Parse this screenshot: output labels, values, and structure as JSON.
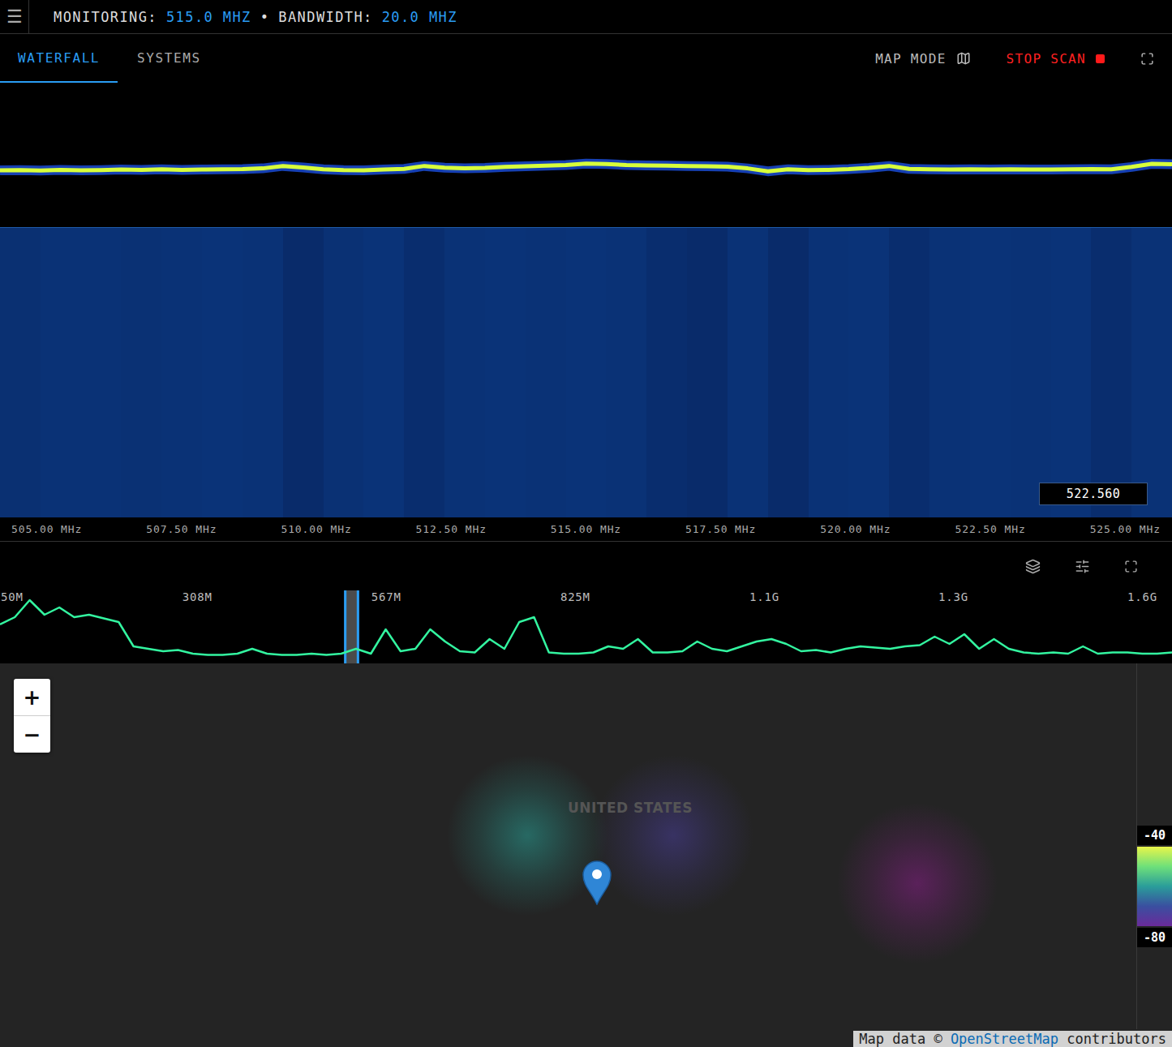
{
  "header": {
    "menu_icon": "☰",
    "separator": "•",
    "items": [
      {
        "label": "MONITORING:",
        "value": "515.0 MHZ"
      },
      {
        "label": "BANDWIDTH:",
        "value": "20.0 MHZ"
      }
    ]
  },
  "tabs": [
    {
      "label": "WATERFALL",
      "selected": true
    },
    {
      "label": "SYSTEMS",
      "selected": false
    }
  ],
  "actions": {
    "map_mode": "MAP MODE",
    "stop_scan": "STOP SCAN"
  },
  "spectrum": {
    "values": [
      -76.4,
      -76.3,
      -76.5,
      -76.2,
      -76.4,
      -76.3,
      -76.1,
      -76.2,
      -76.0,
      -76.2,
      -76.1,
      -76.0,
      -75.9,
      -75.6,
      -74.6,
      -75.2,
      -76.0,
      -76.3,
      -76.4,
      -76.1,
      -75.8,
      -74.6,
      -75.3,
      -75.6,
      -75.4,
      -75.0,
      -74.7,
      -74.5,
      -74.2,
      -73.6,
      -73.8,
      -74.2,
      -74.4,
      -74.5,
      -74.6,
      -74.7,
      -74.9,
      -75.6,
      -76.8,
      -76.0,
      -76.3,
      -76.2,
      -75.9,
      -75.4,
      -74.6,
      -75.8,
      -76.0,
      -76.1,
      -76.0,
      -76.1,
      -76.0,
      -76.1,
      -76.1,
      -76.0,
      -75.9,
      -76.0,
      -75.0,
      -73.7,
      -73.9
    ]
  },
  "waterfall": {
    "columns": [
      0.55,
      0.6,
      0.6,
      0.58,
      0.6,
      0.62,
      0.6,
      0.45,
      0.58,
      0.62,
      0.5,
      0.6,
      0.62,
      0.6,
      0.62,
      0.6,
      0.5,
      0.45,
      0.6,
      0.45,
      0.6,
      0.62,
      0.5,
      0.6,
      0.62,
      0.6,
      0.62,
      0.5,
      0.6
    ],
    "cursor": "522.560",
    "ticks": [
      "505.00 MHz",
      "507.50 MHz",
      "510.00 MHz",
      "512.50 MHz",
      "515.00 MHz",
      "517.50 MHz",
      "520.00 MHz",
      "522.50 MHz",
      "525.00 MHz"
    ]
  },
  "overview": {
    "ticks": [
      "50M",
      "308M",
      "567M",
      "825M",
      "1.1G",
      "1.3G",
      "1.6G"
    ],
    "values": [
      -68,
      -62,
      -48,
      -60,
      -54,
      -62,
      -60,
      -63,
      -66,
      -86,
      -88,
      -90,
      -89,
      -92,
      -93,
      -93,
      -92,
      -88,
      -92,
      -93,
      -93,
      -92,
      -93,
      -92,
      -88,
      -92,
      -72,
      -90,
      -88,
      -72,
      -82,
      -90,
      -91,
      -80,
      -88,
      -66,
      -62,
      -91,
      -92,
      -92,
      -91,
      -86,
      -88,
      -80,
      -91,
      -91,
      -90,
      -82,
      -88,
      -90,
      -86,
      -82,
      -80,
      -84,
      -90,
      -89,
      -91,
      -88,
      -86,
      -87,
      -88,
      -86,
      -85,
      -78,
      -84,
      -76,
      -88,
      -80,
      -88,
      -91,
      -92,
      -91,
      -92,
      -86,
      -92,
      -91,
      -91,
      -92,
      -92,
      -91
    ]
  },
  "map": {
    "label": "UNITED STATES",
    "zoom": [
      "+",
      "−"
    ],
    "pin": {
      "lat": 34.4,
      "lon": -103.2
    },
    "hotspots": [
      {
        "lat": 39.3,
        "lon": -108.2,
        "color": "#2aa59a"
      },
      {
        "lat": 39.3,
        "lon": -97.7,
        "color": "#4a3f9a"
      },
      {
        "lat": 35.9,
        "lon": -80.1,
        "color": "#8a1f8a"
      }
    ],
    "legend": {
      "max": "-40",
      "min": "-80"
    },
    "attribution": {
      "prefix": "Map data © ",
      "link": "OpenStreetMap",
      "suffix": " contributors"
    }
  }
}
